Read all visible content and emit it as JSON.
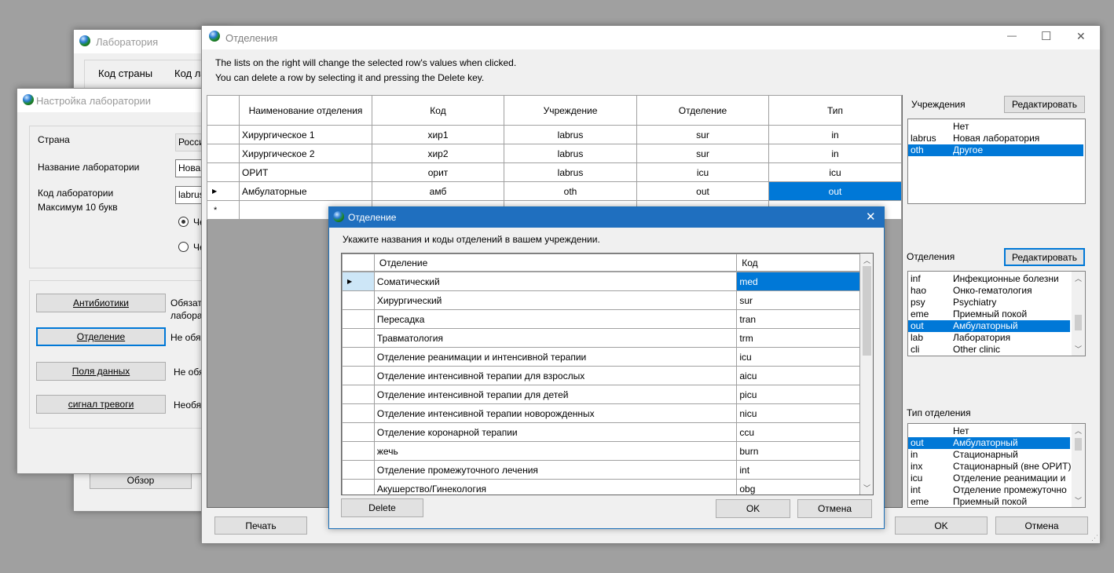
{
  "lab_window": {
    "title": "Лаборатория",
    "col_country_code": "Код страны",
    "col_lab_code": "Код ла",
    "browse_button": "Обзор"
  },
  "setup_window": {
    "title": "Настройка лаборатории",
    "country_label": "Страна",
    "country_value": "Росси",
    "lab_name_label": "Название лаборатории",
    "lab_name_value": "Нова",
    "lab_code_label": "Код лаборатории",
    "lab_code_hint": "Максимум 10 букв",
    "lab_code_value": "labrus",
    "radio1_label": "Че",
    "radio2_label": "Че",
    "buttons": [
      {
        "label": "Антибиотики",
        "status": "Обязат",
        "status2": "лабора"
      },
      {
        "label": "Отделение",
        "status": "Не обя"
      },
      {
        "label": "Поля данных",
        "status": "Не обя"
      },
      {
        "label": "сигнал тревоги",
        "status": "Необя"
      }
    ]
  },
  "dept_window": {
    "title": "Отделения",
    "controls": {
      "minimize": "—",
      "maximize": "☐",
      "close": "✕"
    },
    "info_line1": "The lists on the right will change the selected row's values when clicked.",
    "info_line2": "You can delete a row by selecting it and pressing the Delete key.",
    "columns": [
      "Наименование отделения",
      "Код",
      "Учреждение",
      "Отделение",
      "Тип"
    ],
    "rows": [
      [
        "Хирургическое 1",
        "хир1",
        "labrus",
        "sur",
        "in"
      ],
      [
        "Хирургическое 2",
        "хир2",
        "labrus",
        "sur",
        "in"
      ],
      [
        "ОРИТ",
        "орит",
        "labrus",
        "icu",
        "icu"
      ],
      [
        "Амбулаторные",
        "амб",
        "oth",
        "out",
        "out"
      ]
    ],
    "new_row_marker": "*",
    "current_row_marker": "▶",
    "institutions_label": "Учреждения",
    "institutions_edit": "Редактировать",
    "institutions": [
      {
        "code": "",
        "name": "Нет",
        "selected": false
      },
      {
        "code": "labrus",
        "name": "Новая лаборатория",
        "selected": false
      },
      {
        "code": "oth",
        "name": "Другое",
        "selected": true
      }
    ],
    "departments_label": "Отделения",
    "departments_edit": "Редактировать",
    "departments": [
      {
        "code": "inf",
        "name": "Инфекционные болезни",
        "selected": false
      },
      {
        "code": "hao",
        "name": "Онко-гематология",
        "selected": false
      },
      {
        "code": "psy",
        "name": "Psychiatry",
        "selected": false
      },
      {
        "code": "eme",
        "name": "Приемный покой",
        "selected": false
      },
      {
        "code": "out",
        "name": "Амбулаторный",
        "selected": true
      },
      {
        "code": "lab",
        "name": "Лаборатория",
        "selected": false
      },
      {
        "code": "cli",
        "name": "Other clinic",
        "selected": false
      }
    ],
    "dept_type_label": "Тип отделения",
    "dept_types": [
      {
        "code": "",
        "name": "Нет",
        "selected": false
      },
      {
        "code": "out",
        "name": "Амбулаторный",
        "selected": true
      },
      {
        "code": "in",
        "name": "Стационарный",
        "selected": false
      },
      {
        "code": "inx",
        "name": "Стационарный (вне ОРИТ)",
        "selected": false
      },
      {
        "code": "icu",
        "name": "Отделение реанимации и",
        "selected": false
      },
      {
        "code": "int",
        "name": "Отделение промежуточно",
        "selected": false
      },
      {
        "code": "eme",
        "name": "Приемный покой",
        "selected": false
      }
    ],
    "print_button": "Печать",
    "ok_button": "OK",
    "cancel_button": "Отмена"
  },
  "dialog": {
    "title": "Отделение",
    "close": "✕",
    "instruction": "Укажите названия и коды отделений в вашем учреждении.",
    "columns": [
      "Отделение",
      "Код"
    ],
    "rows": [
      [
        "Соматический",
        "med"
      ],
      [
        "Хирургический",
        "sur"
      ],
      [
        "Пересадка",
        "tran"
      ],
      [
        "Травматология",
        "trm"
      ],
      [
        "Отделение реанимации и интенсивной терапии",
        "icu"
      ],
      [
        "Отделение интенсивной терапии для взрослых",
        "aicu"
      ],
      [
        "Отделение интенсивной терапии для детей",
        "picu"
      ],
      [
        "Отделение интенсивной терапии новорожденных",
        "nicu"
      ],
      [
        "Отделение коронарной терапии",
        "ccu"
      ],
      [
        "жечь",
        "burn"
      ],
      [
        "Отделение промежуточного лечения",
        "int"
      ],
      [
        "Акушерство/Гинекология",
        "obg"
      ]
    ],
    "current_row_marker": "▶",
    "delete_button": "Delete",
    "ok_button": "OK",
    "cancel_button": "Отмена"
  }
}
